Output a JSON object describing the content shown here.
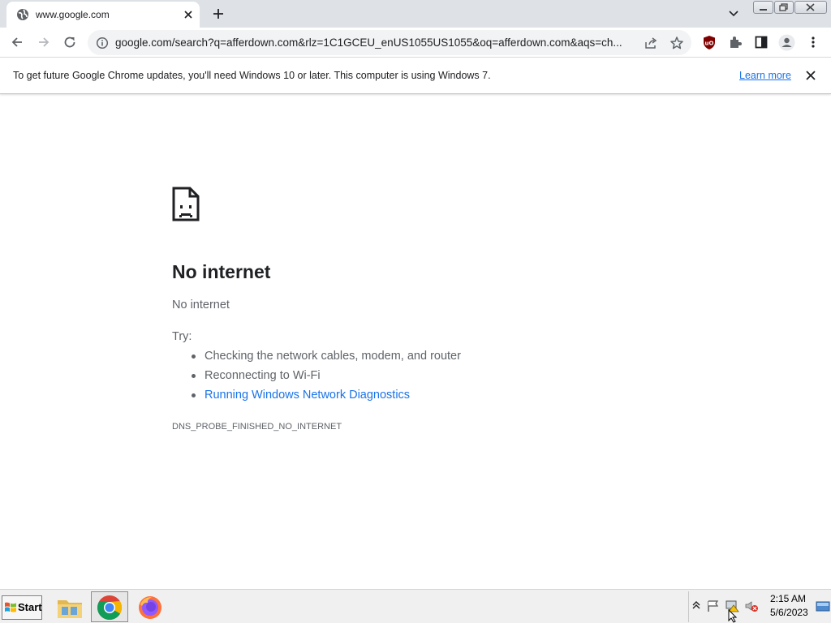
{
  "tab": {
    "title": "www.google.com"
  },
  "omnibox": {
    "url": "google.com/search?q=afferdown.com&rlz=1C1GCEU_enUS1055US1055&oq=afferdown.com&aqs=ch..."
  },
  "infobar": {
    "message": "To get future Google Chrome updates, you'll need Windows 10 or later. This computer is using Windows 7.",
    "link": "Learn more"
  },
  "error": {
    "title": "No internet",
    "subtitle": "No internet",
    "try_label": "Try:",
    "suggestions": [
      "Checking the network cables, modem, and router",
      "Reconnecting to Wi-Fi",
      "Running Windows Network Diagnostics"
    ],
    "code": "DNS_PROBE_FINISHED_NO_INTERNET"
  },
  "taskbar": {
    "start_label": "Start",
    "time": "2:15 AM",
    "date": "5/6/2023"
  },
  "colors": {
    "link": "#1a73e8",
    "tab_strip": "#dee1e6",
    "text_secondary": "#5f6368"
  }
}
